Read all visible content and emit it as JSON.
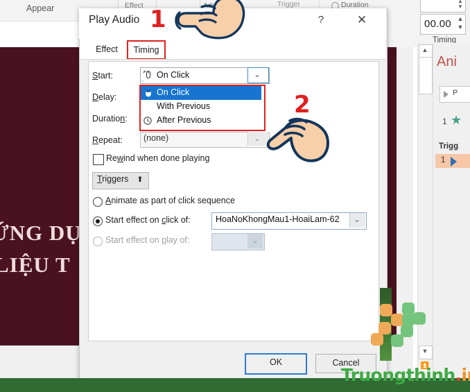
{
  "app": {
    "ribbon": {
      "appear_label": "Appear",
      "effect_label": "Effect",
      "add_label": "Add",
      "trigger_label": "Trigger",
      "duration_label": "Duration",
      "duration_value": "00.00",
      "timing_group_label": "Timing",
      "spinner_up_icon": "chevron-up-icon",
      "spinner_down_icon": "chevron-down-icon"
    },
    "slide": {
      "line1": "ỨNG DỤ",
      "line2": "LIỆU T",
      "background_color": "#4a1220",
      "text_color": "#f0dcdc"
    },
    "scrollbar": {
      "up_icon": "▲",
      "down_icon": "▼",
      "double_up_icon": "▲"
    },
    "animation_pane": {
      "title": "Ani",
      "play_button_label": "P",
      "play_icon": "play-triangle-icon",
      "item_number": "1",
      "item_icon": "star-icon",
      "triggers_label": "Trigg",
      "trigger_number": "1",
      "trigger_icon": "play-triangle-icon",
      "highlight_color": "#f7c7a8"
    }
  },
  "dialog": {
    "title": "Play Audio",
    "help_icon": "?",
    "close_icon": "✕",
    "tabs": [
      {
        "label": "Effect",
        "selected": false
      },
      {
        "label": "Timing",
        "selected": true
      }
    ],
    "fields": {
      "start_label": "Start:",
      "start_label_key": "S",
      "start_value": "On Click",
      "start_icon": "mouse-click-icon",
      "start_arrow_icon": "chevron-down-icon",
      "delay_label": "Delay:",
      "delay_label_key": "D",
      "duration_label": "Duration:",
      "duration_label_key": "n",
      "repeat_label": "Repeat:",
      "repeat_label_key": "R",
      "repeat_value": "(none)",
      "repeat_arrow_icon": "chevron-down-icon"
    },
    "dropdown_options": [
      {
        "label": "On Click",
        "icon": "mouse-click-icon",
        "selected": true
      },
      {
        "label": "With Previous",
        "icon": "",
        "selected": false
      },
      {
        "label": "After Previous",
        "icon": "clock-icon",
        "selected": false
      }
    ],
    "rewind_checkbox": {
      "label": "Rewind when done playing",
      "checked": false
    },
    "triggers_button": {
      "label": "Triggers",
      "icon": "double-chevron-up-icon"
    },
    "radios": [
      {
        "label": "Animate as part of click sequence",
        "selected": false,
        "disabled": false
      },
      {
        "label": "Start effect on click of:",
        "selected": true,
        "disabled": false
      },
      {
        "label": "Start effect on play of:",
        "selected": false,
        "disabled": true
      }
    ],
    "click_of_combo": {
      "value": "HoaNoKhongMau1-HoaiLam-62",
      "arrow_icon": "chevron-down-icon"
    },
    "play_of_combo": {
      "value": "",
      "arrow_icon": "chevron-down-icon"
    },
    "buttons": {
      "ok": "OK",
      "cancel": "Cancel"
    }
  },
  "annotations": {
    "step1": "1",
    "step2": "2",
    "color": "#e02020",
    "hand1_icon": "pointing-hand-icon",
    "hand2_icon": "pointing-hand-icon"
  },
  "watermark": {
    "part1": "Truongthinh",
    "part2": ".",
    "part3": "info",
    "green": "#3faa46",
    "orange": "#f0912d",
    "red": "#e23b2e"
  }
}
